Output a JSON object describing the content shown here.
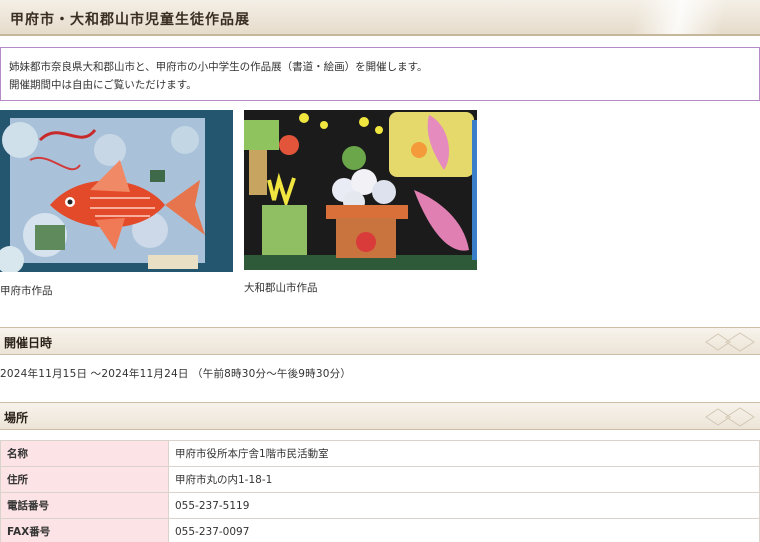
{
  "page": {
    "title": "甲府市・大和郡山市児童生徒作品展",
    "intro": {
      "line1": "姉妹都市奈良県大和郡山市と、甲府市の小中学生の作品展（書道・絵画）を開催します。",
      "line2": "開催期間中は自由にご覧いただけます。"
    }
  },
  "gallery": [
    {
      "caption": "甲府市作品",
      "icon": "goldfish-collage-artwork"
    },
    {
      "caption": "大和郡山市作品",
      "icon": "flowers-collage-artwork"
    }
  ],
  "schedule": {
    "heading": "開催日時",
    "text": "2024年11月15日 ～2024年11月24日 （午前8時30分～午後9時30分）"
  },
  "venue": {
    "heading": "場所",
    "rows": [
      {
        "key": "名称",
        "value": "甲府市役所本庁舎1階市民活動室"
      },
      {
        "key": "住所",
        "value": "甲府市丸の内1-18-1"
      },
      {
        "key": "電話番号",
        "value": "055-237-5119"
      },
      {
        "key": "FAX番号",
        "value": "055-237-0097"
      }
    ]
  },
  "colors": {
    "intro_border": "#b68ac7",
    "table_key_bg": "#fbe3e6",
    "header_bg": "#ece4d6"
  }
}
